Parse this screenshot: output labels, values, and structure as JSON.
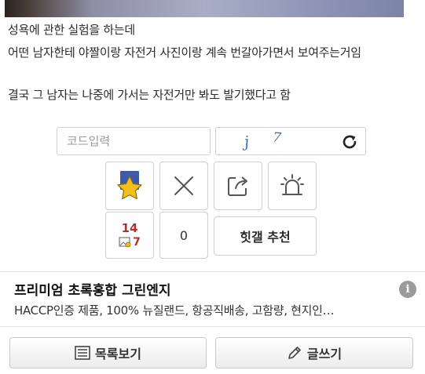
{
  "post": {
    "line1": "성욕에 관한 실험을 하는데",
    "line2": "어떤 남자한테 야짤이랑 자전거 사진이랑 계속 번갈아가면서 보여주는거임",
    "line3": "결국 그 남자는 나중에 가서는 자전거만 봐도 발기했다고 함"
  },
  "captcha": {
    "input_placeholder": "코드입력",
    "code_chars": [
      "j",
      "7"
    ]
  },
  "actions": {
    "scrap_count": "14",
    "image_count": "7",
    "downvote_count": "0",
    "recommend_label": "힛갤 추천"
  },
  "ad": {
    "title": "프리미엄 초록홍합 그린엔지",
    "description": "HACCP인증 제품, 100% 뉴질랜드, 항공직배송, 고함량, 현지인…",
    "info_icon": "i"
  },
  "footer": {
    "list_label": "목록보기",
    "write_label": "글쓰기"
  },
  "colors": {
    "count_red": "#b03030",
    "captcha_blue": "#3a6fb3",
    "star_gold": "#f3c01b",
    "star_blue": "#3d5aa8"
  }
}
